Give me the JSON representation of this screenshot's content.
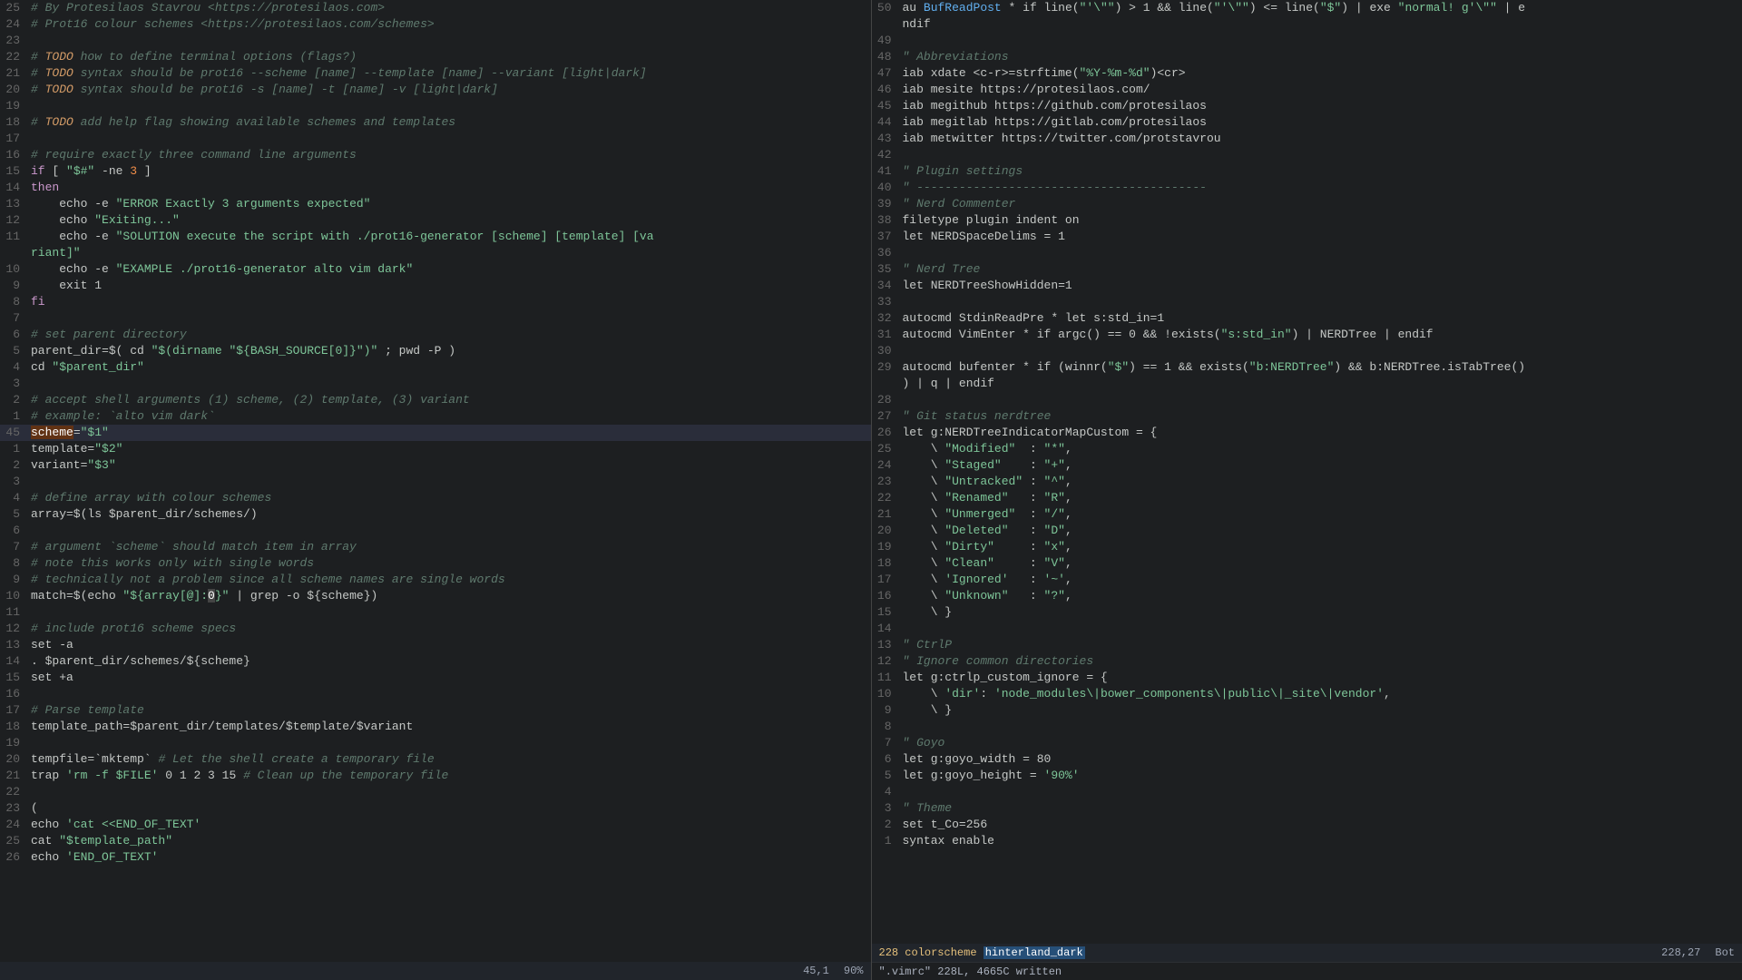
{
  "left_pane": {
    "lines": [
      {
        "num": "25",
        "content": "# By Protesilaos Stavrou <https://protesilaos.com>",
        "type": "comment"
      },
      {
        "num": "24",
        "content": "# Prot16 colour schemes <https://protesilaos.com/schemes>",
        "type": "comment"
      },
      {
        "num": "23",
        "content": "",
        "type": "plain"
      },
      {
        "num": "22",
        "content": "# TODO how to define terminal options (flags?)",
        "type": "todo"
      },
      {
        "num": "21",
        "content": "# TODO syntax should be prot16 --scheme [name] --template [name] --variant [light|dark]",
        "type": "todo"
      },
      {
        "num": "20",
        "content": "# TODO syntax should be prot16 -s [name] -t [name] -v [light|dark]",
        "type": "todo"
      },
      {
        "num": "19",
        "content": "",
        "type": "plain"
      },
      {
        "num": "18",
        "content": "# TODO add help flag showing available schemes and templates",
        "type": "todo"
      },
      {
        "num": "17",
        "content": "",
        "type": "plain"
      },
      {
        "num": "16",
        "content": "# require exactly three command line arguments",
        "type": "comment"
      },
      {
        "num": "15",
        "content": "if [ \"$#\" -ne 3 ]",
        "type": "code"
      },
      {
        "num": "14",
        "content": "then",
        "type": "keyword"
      },
      {
        "num": "13",
        "content": "    echo -e \"ERROR Exactly 3 arguments expected\"",
        "type": "code"
      },
      {
        "num": "12",
        "content": "    echo \"Exiting...\"",
        "type": "code"
      },
      {
        "num": "11",
        "content": "    echo -e \"SOLUTION execute the script with ./prot16-generator [scheme] [template] [va",
        "type": "code"
      },
      {
        "num": "",
        "content": "riant]\"",
        "type": "code"
      },
      {
        "num": "10",
        "content": "    echo -e \"EXAMPLE ./prot16-generator alto vim dark\"",
        "type": "code"
      },
      {
        "num": "9",
        "content": "    exit 1",
        "type": "code"
      },
      {
        "num": "8",
        "content": "fi",
        "type": "keyword"
      },
      {
        "num": "7",
        "content": "",
        "type": "plain"
      },
      {
        "num": "6",
        "content": "# set parent directory",
        "type": "comment"
      },
      {
        "num": "5",
        "content": "parent_dir=$( cd \"$(dirname \"${BASH_SOURCE[0]}\")\" ; pwd -P )",
        "type": "code"
      },
      {
        "num": "4",
        "content": "cd \"$parent_dir\"",
        "type": "code"
      },
      {
        "num": "3",
        "content": "",
        "type": "plain"
      },
      {
        "num": "2",
        "content": "# accept shell arguments (1) scheme, (2) template, (3) variant",
        "type": "comment"
      },
      {
        "num": "1",
        "content": "# example: `alto vim dark`",
        "type": "comment"
      },
      {
        "num": "45",
        "content": "scheme=\"$1\"",
        "type": "highlighted"
      },
      {
        "num": "1",
        "content": "template=\"$2\"",
        "type": "code"
      },
      {
        "num": "2",
        "content": "variant=\"$3\"",
        "type": "code"
      },
      {
        "num": "3",
        "content": "",
        "type": "plain"
      },
      {
        "num": "4",
        "content": "# define array with colour schemes",
        "type": "comment"
      },
      {
        "num": "5",
        "content": "array=$(ls $parent_dir/schemes/)",
        "type": "code"
      },
      {
        "num": "6",
        "content": "",
        "type": "plain"
      },
      {
        "num": "7",
        "content": "# argument `scheme` should match item in array",
        "type": "comment"
      },
      {
        "num": "8",
        "content": "# note this works only with single words",
        "type": "comment"
      },
      {
        "num": "9",
        "content": "# technically not a problem since all scheme names are single words",
        "type": "comment"
      },
      {
        "num": "10",
        "content": "match=$(echo \"${array[@]:0}\" | grep -o ${scheme})",
        "type": "code"
      },
      {
        "num": "11",
        "content": "",
        "type": "plain"
      },
      {
        "num": "12",
        "content": "# include prot16 scheme specs",
        "type": "comment"
      },
      {
        "num": "13",
        "content": "set -a",
        "type": "code"
      },
      {
        "num": "14",
        "content": ". $parent_dir/schemes/${scheme}",
        "type": "code"
      },
      {
        "num": "15",
        "content": "set +a",
        "type": "code"
      },
      {
        "num": "16",
        "content": "",
        "type": "plain"
      },
      {
        "num": "17",
        "content": "# Parse template",
        "type": "comment"
      },
      {
        "num": "18",
        "content": "template_path=$parent_dir/templates/$template/$variant",
        "type": "code"
      },
      {
        "num": "19",
        "content": "",
        "type": "plain"
      },
      {
        "num": "20",
        "content": "tempfile=`mktemp` # Let the shell create a temporary file",
        "type": "code"
      },
      {
        "num": "21",
        "content": "trap 'rm -f $FILE' 0 1 2 3 15 # Clean up the temporary file",
        "type": "code"
      },
      {
        "num": "22",
        "content": "",
        "type": "plain"
      },
      {
        "num": "23",
        "content": "(",
        "type": "code"
      },
      {
        "num": "24",
        "content": "echo 'cat <<END_OF_TEXT'",
        "type": "code"
      },
      {
        "num": "25",
        "content": "cat \"$template_path\"",
        "type": "code"
      },
      {
        "num": "26",
        "content": "echo 'END_OF_TEXT'",
        "type": "code"
      }
    ],
    "status": {
      "mode": "",
      "position": "45,1",
      "percent": "90%"
    }
  },
  "right_pane": {
    "lines": [
      {
        "num": "50",
        "content": "au BufReadPost * if line(\"'\\\"\") > 1 && line(\"'\\\"\") <= line(\"$\") | exe \"normal! g'\\\"\" | e",
        "type": "code"
      },
      {
        "num": "",
        "content": "ndif",
        "type": "code"
      },
      {
        "num": "49",
        "content": "",
        "type": "plain"
      },
      {
        "num": "48",
        "content": "\" Abbreviations",
        "type": "comment"
      },
      {
        "num": "47",
        "content": "iab xdate <c-r>=strftime(\"%Y-%m-%d\")<cr>",
        "type": "code"
      },
      {
        "num": "46",
        "content": "iab mesite https://protesilaos.com/",
        "type": "code"
      },
      {
        "num": "45",
        "content": "iab megithub https://github.com/protesilaos",
        "type": "code"
      },
      {
        "num": "44",
        "content": "iab megitlab https://gitlab.com/protesilaos",
        "type": "code"
      },
      {
        "num": "43",
        "content": "iab metwitter https://twitter.com/protstavrou",
        "type": "code"
      },
      {
        "num": "42",
        "content": "",
        "type": "plain"
      },
      {
        "num": "41",
        "content": "\" Plugin settings",
        "type": "comment"
      },
      {
        "num": "40",
        "content": "\" -----------------------------------------",
        "type": "comment"
      },
      {
        "num": "39",
        "content": "\" Nerd Commenter",
        "type": "comment"
      },
      {
        "num": "38",
        "content": "filetype plugin indent on",
        "type": "code"
      },
      {
        "num": "37",
        "content": "let NERDSpaceDelims = 1",
        "type": "code"
      },
      {
        "num": "36",
        "content": "",
        "type": "plain"
      },
      {
        "num": "35",
        "content": "\" Nerd Tree",
        "type": "comment"
      },
      {
        "num": "34",
        "content": "let NERDTreeShowHidden=1",
        "type": "code"
      },
      {
        "num": "33",
        "content": "",
        "type": "plain"
      },
      {
        "num": "32",
        "content": "autocmd StdinReadPre * let s:std_in=1",
        "type": "code"
      },
      {
        "num": "31",
        "content": "autocmd VimEnter * if argc() == 0 && !exists(\"s:std_in\") | NERDTree | endif",
        "type": "code"
      },
      {
        "num": "30",
        "content": "",
        "type": "plain"
      },
      {
        "num": "29",
        "content": "autocmd bufenter * if (winnr(\"$\") == 1 && exists(\"b:NERDTree\") && b:NERDTree.isTabTree()",
        "type": "code"
      },
      {
        "num": "",
        "content": ") | q | endif",
        "type": "code"
      },
      {
        "num": "28",
        "content": "",
        "type": "plain"
      },
      {
        "num": "27",
        "content": "\" Git status nerdtree",
        "type": "comment"
      },
      {
        "num": "26",
        "content": "let g:NERDTreeIndicatorMapCustom = {",
        "type": "code"
      },
      {
        "num": "25",
        "content": "    \\ \"Modified\"  : \"*\",",
        "type": "code"
      },
      {
        "num": "24",
        "content": "    \\ \"Staged\"    : \"+\",",
        "type": "code"
      },
      {
        "num": "23",
        "content": "    \\ \"Untracked\" : \"^\",",
        "type": "code"
      },
      {
        "num": "22",
        "content": "    \\ \"Renamed\"   : \"R\",",
        "type": "code"
      },
      {
        "num": "21",
        "content": "    \\ \"Unmerged\"  : \"/\",",
        "type": "code"
      },
      {
        "num": "20",
        "content": "    \\ \"Deleted\"   : \"D\",",
        "type": "code"
      },
      {
        "num": "19",
        "content": "    \\ \"Dirty\"     : \"x\",",
        "type": "code"
      },
      {
        "num": "18",
        "content": "    \\ \"Clean\"     : \"V\",",
        "type": "code"
      },
      {
        "num": "17",
        "content": "    \\ 'Ignored'   : '~',",
        "type": "code"
      },
      {
        "num": "16",
        "content": "    \\ \"Unknown\"   : \"?\",",
        "type": "code"
      },
      {
        "num": "15",
        "content": "    \\ }",
        "type": "code"
      },
      {
        "num": "14",
        "content": "",
        "type": "plain"
      },
      {
        "num": "13",
        "content": "\" CtrlP",
        "type": "comment"
      },
      {
        "num": "12",
        "content": "\" Ignore common directories",
        "type": "comment"
      },
      {
        "num": "11",
        "content": "let g:ctrlp_custom_ignore = {",
        "type": "code"
      },
      {
        "num": "10",
        "content": "    \\ 'dir': 'node_modules\\|bower_components\\|public\\|_site\\|vendor',",
        "type": "code"
      },
      {
        "num": "9",
        "content": "    \\ }",
        "type": "code"
      },
      {
        "num": "8",
        "content": "",
        "type": "plain"
      },
      {
        "num": "7",
        "content": "\" Goyo",
        "type": "comment"
      },
      {
        "num": "6",
        "content": "let g:goyo_width = 80",
        "type": "code"
      },
      {
        "num": "5",
        "content": "let g:goyo_height = '90%'",
        "type": "code"
      },
      {
        "num": "4",
        "content": "",
        "type": "plain"
      },
      {
        "num": "3",
        "content": "\" Theme",
        "type": "comment"
      },
      {
        "num": "2",
        "content": "set t_Co=256",
        "type": "code"
      },
      {
        "num": "1",
        "content": "syntax enable",
        "type": "code"
      }
    ],
    "status_line": {
      "line_num": "228",
      "mode_indicator": "colorscheme hinterland_dark",
      "position": "228,27",
      "bot": "Bot"
    },
    "cmd_line": "\".vimrc\" 228L, 4665C written"
  }
}
